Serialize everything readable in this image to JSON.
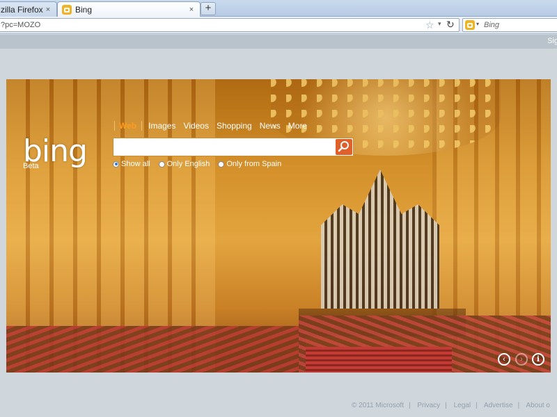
{
  "browser": {
    "tabs": [
      {
        "label": "zilla Firefox",
        "active": false
      },
      {
        "label": "Bing",
        "active": true
      }
    ],
    "new_tab_label": "+",
    "close_label": "×",
    "url": "?pc=MOZO",
    "search_placeholder": "Bing"
  },
  "page": {
    "signin": "Sig",
    "logo_text": "bing",
    "logo_beta": "Beta",
    "scopes": [
      "Web",
      "Images",
      "Videos",
      "Shopping",
      "News",
      "More"
    ],
    "active_scope": "Web",
    "search": {
      "value": "",
      "placeholder": ""
    },
    "language_options": [
      {
        "label": "Show all",
        "selected": true
      },
      {
        "label": "Only English",
        "selected": false
      },
      {
        "label": "Only from Spain",
        "selected": false
      }
    ],
    "hero_controls": {
      "prev_label": "‹",
      "next_label": "›",
      "info_label": "i"
    }
  },
  "footer": {
    "copyright": "© 2011 Microsoft",
    "links": [
      "Privacy",
      "Legal",
      "Advertise",
      "About o"
    ]
  },
  "colors": {
    "accent": "#ff9c1f",
    "search_button": "#e0602b",
    "favicon": "#f0b323"
  },
  "icons": {
    "favicon": "bing-favicon-icon",
    "star": "bookmark-star-icon",
    "reload": "reload-icon",
    "search": "magnifier-icon",
    "info": "info-icon"
  }
}
